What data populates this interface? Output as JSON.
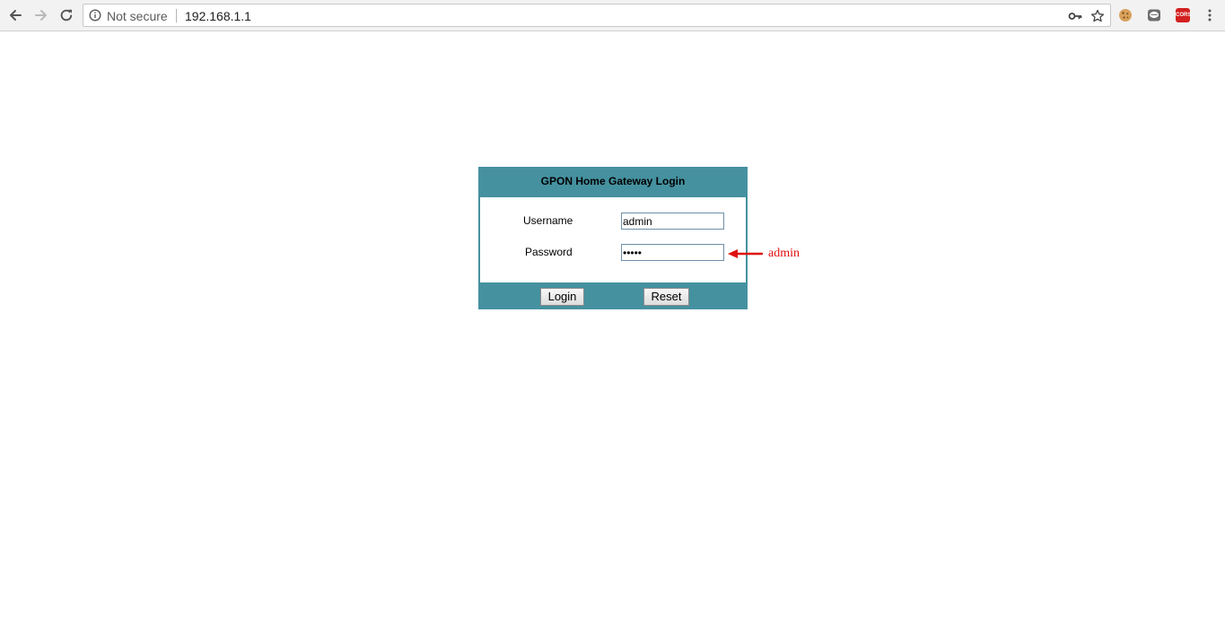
{
  "browser": {
    "security_label": "Not secure",
    "url": "192.168.1.1",
    "extensions": {
      "cors_label": "CORS"
    },
    "icons": {
      "back": "arrow-left-icon",
      "forward": "arrow-right-icon",
      "reload": "reload-icon",
      "info": "info-circle-icon",
      "key": "key-icon",
      "bookmark": "star-icon",
      "cookie": "cookie-icon",
      "chat": "chat-bubble-icon",
      "menu": "kebab-menu-icon"
    }
  },
  "login": {
    "title": "GPON Home Gateway Login",
    "username_label": "Username",
    "username_value": "admin",
    "password_label": "Password",
    "password_value": "admin",
    "login_button": "Login",
    "reset_button": "Reset"
  },
  "annotation": {
    "text": "admin",
    "color": "#e01010"
  },
  "colors": {
    "panel": "#4591a0",
    "annotation": "#e01010"
  }
}
